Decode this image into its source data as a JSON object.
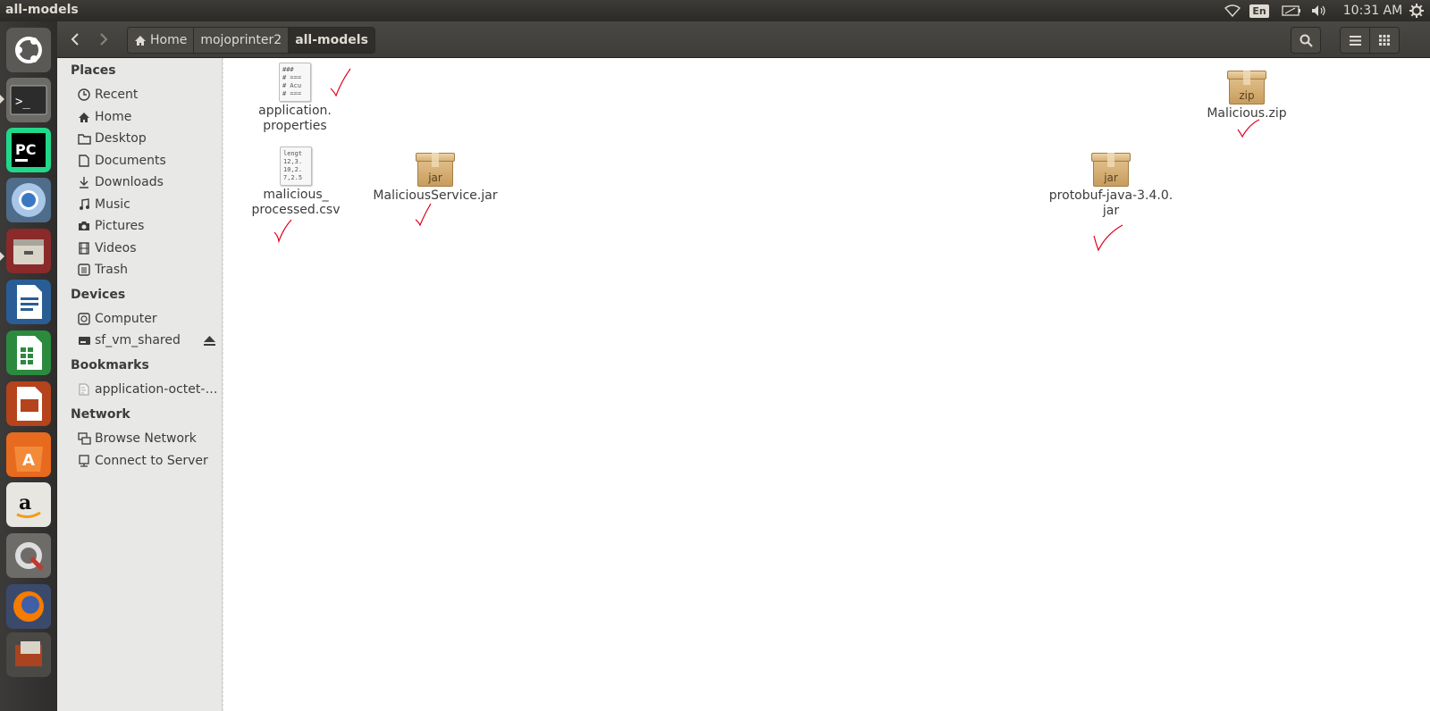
{
  "window": {
    "title": "all-models"
  },
  "system_tray": {
    "language": "En",
    "clock": "10:31 AM",
    "icons": [
      "wifi-icon",
      "battery-icon",
      "volume-icon",
      "session-gear-icon"
    ]
  },
  "launcher": {
    "items": [
      "ubuntu-dash",
      "terminal",
      "pycharm",
      "chromium",
      "files",
      "libreoffice-writer",
      "libreoffice-calc",
      "libreoffice-impress",
      "software-center",
      "amazon",
      "system-settings",
      "firefox",
      "workspaces"
    ]
  },
  "header": {
    "breadcrumb": [
      {
        "label": "Home",
        "icon": "home-icon"
      },
      {
        "label": "mojoprinter2"
      },
      {
        "label": "all-models",
        "active": true
      }
    ]
  },
  "sidebar": {
    "sections": [
      {
        "title": "Places",
        "items": [
          {
            "label": "Recent",
            "icon": "clock-icon"
          },
          {
            "label": "Home",
            "icon": "home-icon"
          },
          {
            "label": "Desktop",
            "icon": "folder-icon"
          },
          {
            "label": "Documents",
            "icon": "document-icon"
          },
          {
            "label": "Downloads",
            "icon": "download-icon"
          },
          {
            "label": "Music",
            "icon": "music-icon"
          },
          {
            "label": "Pictures",
            "icon": "camera-icon"
          },
          {
            "label": "Videos",
            "icon": "film-icon"
          },
          {
            "label": "Trash",
            "icon": "trash-icon"
          }
        ]
      },
      {
        "title": "Devices",
        "items": [
          {
            "label": "Computer",
            "icon": "computer-icon"
          },
          {
            "label": "sf_vm_shared",
            "icon": "drive-icon"
          }
        ]
      },
      {
        "title": "Bookmarks",
        "items": [
          {
            "label": "application-octet-s...",
            "icon": "file-icon"
          }
        ]
      },
      {
        "title": "Network",
        "items": [
          {
            "label": "Browse Network",
            "icon": "network-icon"
          },
          {
            "label": "Connect to Server",
            "icon": "server-icon"
          }
        ]
      }
    ]
  },
  "files": [
    {
      "name_lines": [
        "application.",
        "properties"
      ],
      "type": "text",
      "preview": "### \n# ===\n# Acu\n# ==="
    },
    {
      "name_lines": [
        "malicious_",
        "processed.csv"
      ],
      "type": "text",
      "preview": "lengt\n12,3.\n10,2.\n7,2.5"
    },
    {
      "name_lines": [
        "MaliciousService.jar"
      ],
      "type": "archive",
      "badge": "jar"
    },
    {
      "name_lines": [
        "protobuf-java-3.4.0.",
        "jar"
      ],
      "type": "archive",
      "badge": "jar"
    },
    {
      "name_lines": [
        "Malicious.zip"
      ],
      "type": "archive",
      "badge": "zip"
    }
  ],
  "colors": {
    "annotation_checkmark": "#e0001a",
    "panel": "#3c3b37",
    "sidebar": "#e8e8e7"
  }
}
